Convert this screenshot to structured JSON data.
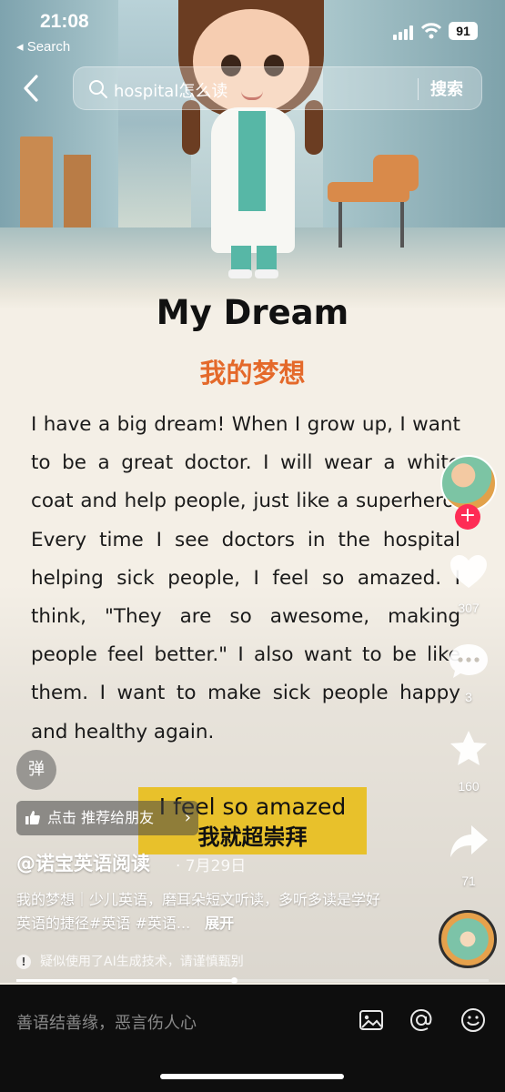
{
  "status_bar": {
    "time": "21:08",
    "back_app": "◂ Search",
    "battery": "91"
  },
  "search": {
    "query": "hospital怎么读",
    "button": "搜索"
  },
  "article": {
    "title": "My Dream",
    "subtitle": "我的梦想",
    "body": "I have a big dream! When I grow up, I want to be a great doctor. I will wear a white coat and help people, just like a superhero. Every time I see doctors in the hospital helping sick people, I feel so amazed. I think, \"They are so awesome, making people feel better.\" I also want to be like them. I want to make sick people happy and healthy again."
  },
  "rail": {
    "like_count": "307",
    "comment_count": "3",
    "favorite_count": "160",
    "share_count": "71"
  },
  "danmaku_label": "弹",
  "recommend": {
    "label": "点击 推荐给朋友"
  },
  "caption": {
    "en": "I feel so amazed",
    "zh": "我就超崇拜"
  },
  "post": {
    "author": "@诺宝英语阅读",
    "date": "· 7月29日",
    "description": "我的梦想｜少儿英语，磨耳朵短文听读，多听多读是学好英语的捷径#英语 #英语...",
    "expand": "展开",
    "ai_notice": "疑似使用了AI生成技术，请谨慎甄别"
  },
  "progress": {
    "fraction": 0.46
  },
  "comment_bar": {
    "placeholder": "善语结善缘，恶言伤人心"
  },
  "icons": {
    "back": "chevron-left-icon",
    "search": "search-icon",
    "like": "heart-icon",
    "comment": "comment-icon",
    "favorite": "star-icon",
    "share": "share-icon",
    "image": "image-icon",
    "mention": "at-icon",
    "emoji": "emoji-icon"
  },
  "colors": {
    "subtitle_orange": "#e4692a",
    "follow_red": "#fe2c55",
    "caption_yellow": "#e8be1e"
  }
}
